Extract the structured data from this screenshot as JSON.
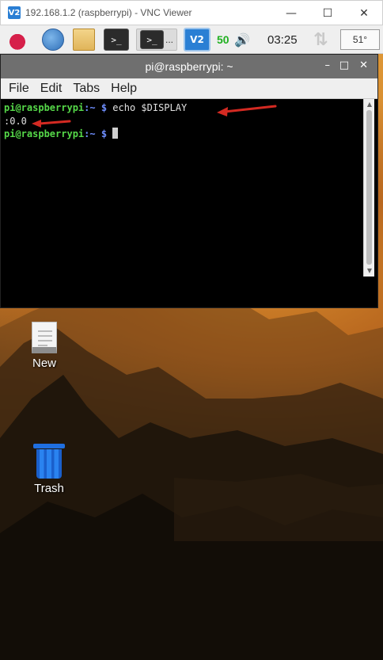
{
  "vnc_window": {
    "title": "192.168.1.2 (raspberrypi) - VNC Viewer",
    "logo_text": "V2",
    "minimize": "—",
    "maximize": "☐",
    "close": "✕"
  },
  "taskbar": {
    "task_buttons": [
      {
        "name": "terminal-task-1",
        "text": ">_"
      },
      {
        "name": "terminal-task-2",
        "text": ">_"
      }
    ],
    "task_dots": "...",
    "vnc_tray_text": "V2",
    "wifi_value": "50",
    "clock": "03:25",
    "temperature": "51°"
  },
  "terminal": {
    "title": "pi@raspberrypi: ~",
    "controls": {
      "minimize": "–",
      "maximize": "□",
      "close": "✕"
    },
    "menu": [
      "File",
      "Edit",
      "Tabs",
      "Help"
    ],
    "lines": [
      {
        "user": "pi@raspberrypi",
        "path": ":~ $ ",
        "cmd": "echo $DISPLAY"
      },
      {
        "output": ":0.0"
      },
      {
        "user": "pi@raspberrypi",
        "path": ":~ $ ",
        "cmd": ""
      }
    ]
  },
  "desktop": {
    "ghost_label": "file-editor",
    "icons": [
      {
        "label": "New"
      },
      {
        "label": "Trash"
      }
    ]
  },
  "colors": {
    "prompt_user": "#56d949",
    "prompt_path": "#6f8fff",
    "annotation_arrow": "#d42a22",
    "terminal_bg": "#000000"
  }
}
